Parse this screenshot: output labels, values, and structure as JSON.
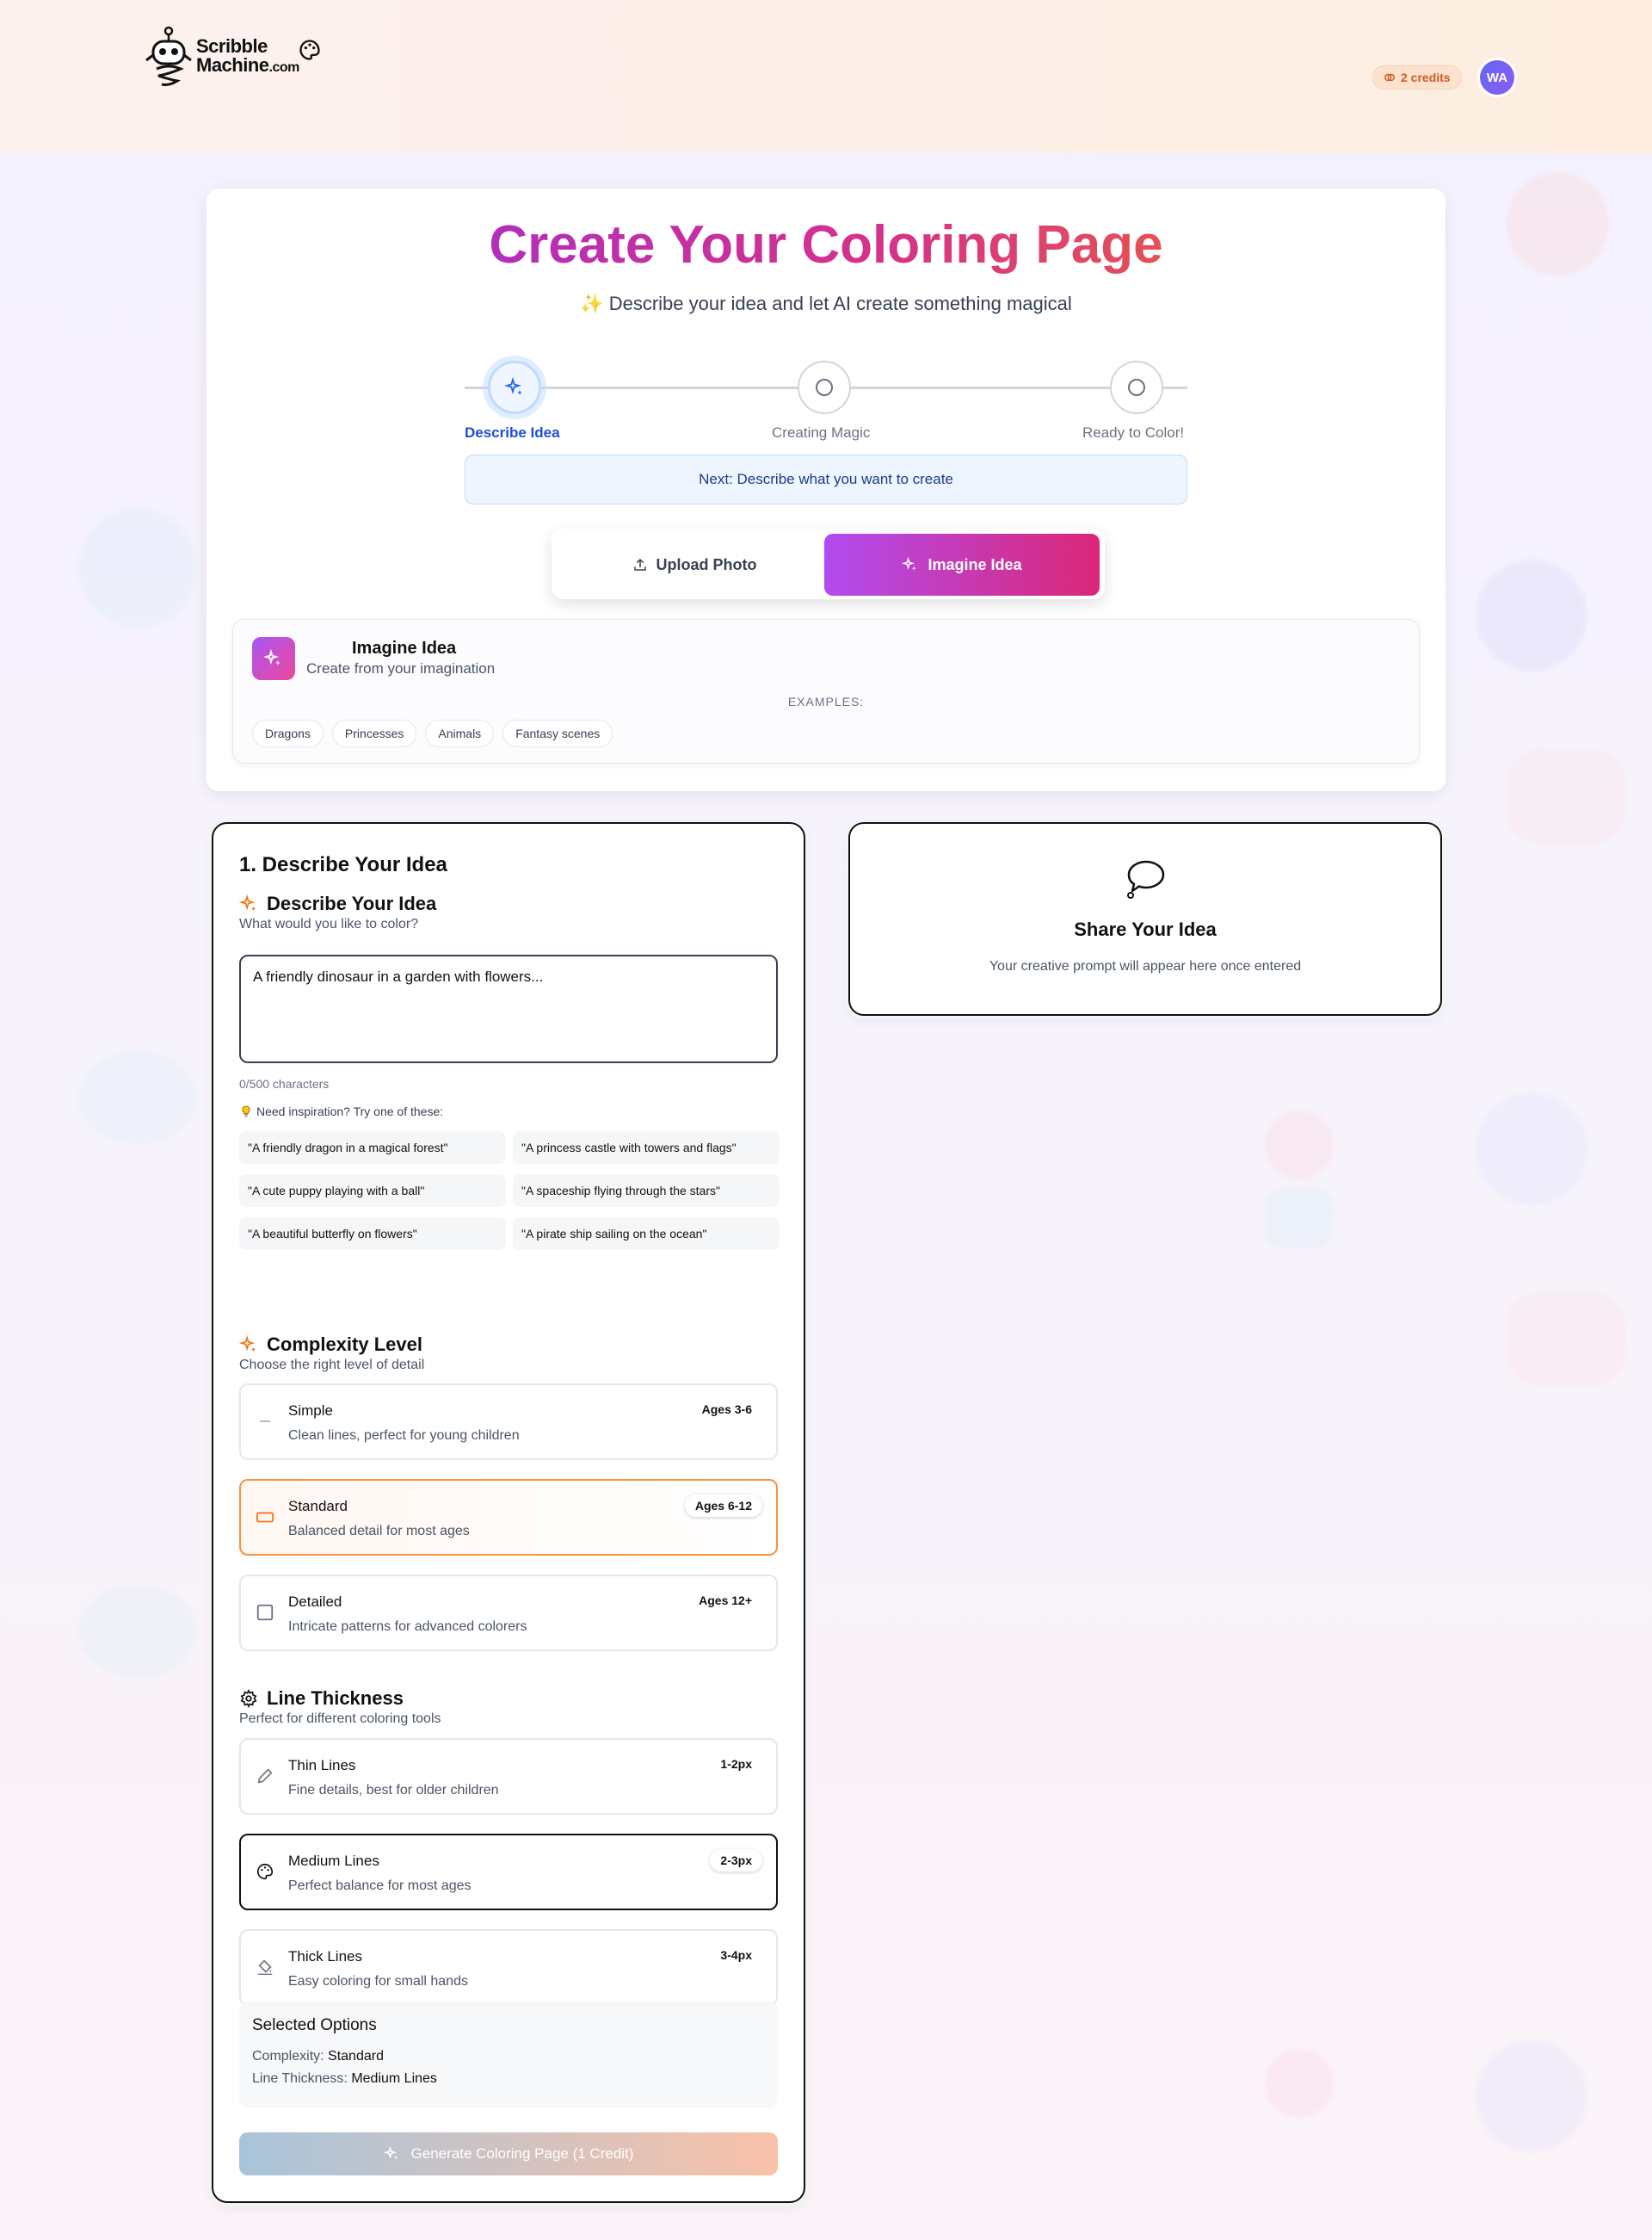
{
  "header": {
    "logo_line1": "Scribble",
    "logo_line2": "Machine",
    "logo_suffix": ".com",
    "credits": "2 credits",
    "avatar_initials": "WA"
  },
  "hero": {
    "title": "Create Your Coloring Page",
    "subtitle": "Describe your idea and let AI create something magical",
    "steps": [
      {
        "label": "Describe Idea",
        "state": "active"
      },
      {
        "label": "Creating Magic",
        "state": "pending"
      },
      {
        "label": "Ready to Color!",
        "state": "pending"
      }
    ],
    "next_hint": "Next: Describe what you want to create",
    "modes": {
      "upload": "Upload Photo",
      "imagine": "Imagine Idea",
      "selected": "imagine"
    },
    "idea_card": {
      "title": "Imagine Idea",
      "subtitle": "Create from your imagination",
      "examples_label": "EXAMPLES:",
      "examples": [
        "Dragons",
        "Princesses",
        "Animals",
        "Fantasy scenes"
      ]
    }
  },
  "form": {
    "panel_title": "1. Describe Your Idea",
    "describe": {
      "heading": "Describe Your Idea",
      "subheading": "What would you like to color?",
      "placeholder": "A friendly dinosaur in a garden with flowers...",
      "value": "",
      "char_count": "0/500 characters",
      "inspiration_label": "Need inspiration? Try one of these:",
      "suggestions": [
        "\"A friendly dragon in a magical forest\"",
        "\"A princess castle with towers and flags\"",
        "\"A cute puppy playing with a ball\"",
        "\"A spaceship flying through the stars\"",
        "\"A beautiful butterfly on flowers\"",
        "\"A pirate ship sailing on the ocean\""
      ]
    },
    "complexity": {
      "heading": "Complexity Level",
      "subheading": "Choose the right level of detail",
      "selected": "Standard",
      "options": [
        {
          "title": "Simple",
          "desc": "Clean lines, perfect for young children",
          "badge": "Ages 3-6",
          "icon": "minus-icon"
        },
        {
          "title": "Standard",
          "desc": "Balanced detail for most ages",
          "badge": "Ages 6-12",
          "icon": "rectangle-icon"
        },
        {
          "title": "Detailed",
          "desc": "Intricate patterns for advanced colorers",
          "badge": "Ages 12+",
          "icon": "square-icon"
        }
      ]
    },
    "thickness": {
      "heading": "Line Thickness",
      "subheading": "Perfect for different coloring tools",
      "selected": "Medium Lines",
      "options": [
        {
          "title": "Thin Lines",
          "desc": "Fine details, best for older children",
          "badge": "1-2px",
          "icon": "pencil-icon"
        },
        {
          "title": "Medium Lines",
          "desc": "Perfect balance for most ages",
          "badge": "2-3px",
          "icon": "palette-icon"
        },
        {
          "title": "Thick Lines",
          "desc": "Easy coloring for small hands",
          "badge": "3-4px",
          "icon": "paint-bucket-icon"
        }
      ]
    },
    "summary": {
      "title": "Selected Options",
      "complexity_label": "Complexity:",
      "complexity_value": "Standard",
      "thickness_label": "Line Thickness:",
      "thickness_value": "Medium Lines"
    },
    "generate_label": "Generate Coloring Page (1 Credit)"
  },
  "preview": {
    "title": "Share Your Idea",
    "subtitle": "Your creative prompt will appear here once entered"
  },
  "colors": {
    "accent_purple": "#9b2bdc",
    "accent_pink": "#db2777",
    "accent_orange": "#f2711f",
    "active_blue": "#1d4ed8"
  }
}
